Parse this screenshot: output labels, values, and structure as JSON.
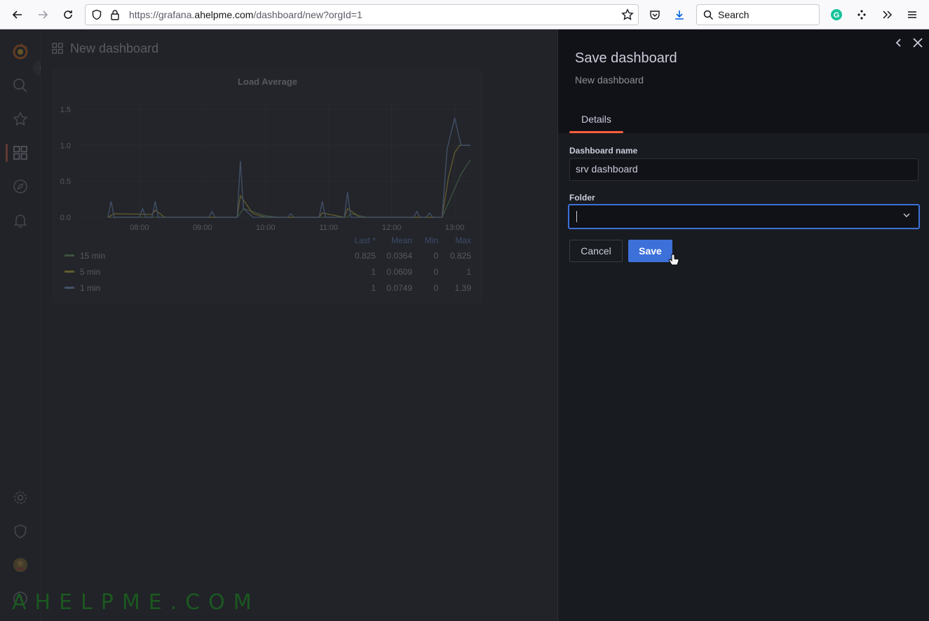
{
  "browser": {
    "url_prefix": "https://grafana.",
    "url_host": "ahelpme.com",
    "url_suffix": "/dashboard/new?orgId=1",
    "search_label": "Search"
  },
  "dashboard": {
    "title": "New dashboard"
  },
  "panel": {
    "title": "Load Average",
    "legend_headers": [
      "Last *",
      "Mean",
      "Min",
      "Max"
    ],
    "legend": [
      {
        "name": "15 min",
        "color": "#73bf69",
        "last": "0.825",
        "mean": "0.0364",
        "min": "0",
        "max": "0.825"
      },
      {
        "name": "5 min",
        "color": "#fade2a",
        "last": "1",
        "mean": "0.0609",
        "min": "0",
        "max": "1"
      },
      {
        "name": "1 min",
        "color": "#8ab8ff",
        "last": "1",
        "mean": "0.0749",
        "min": "0",
        "max": "1.39"
      }
    ]
  },
  "chart_data": {
    "type": "line",
    "title": "Load Average",
    "x_ticks": [
      "08:00",
      "09:00",
      "10:00",
      "11:00",
      "12:00",
      "13:00"
    ],
    "y_ticks": [
      "0.0",
      "0.5",
      "1.0",
      "1.5"
    ],
    "ylim": [
      0,
      1.5
    ],
    "grid": true,
    "series": [
      {
        "name": "1 min",
        "color": "#8ab8ff",
        "points": [
          [
            7.5,
            0
          ],
          [
            7.55,
            0.22
          ],
          [
            7.6,
            0
          ],
          [
            8.0,
            0
          ],
          [
            8.05,
            0.12
          ],
          [
            8.1,
            0
          ],
          [
            8.2,
            0
          ],
          [
            8.25,
            0.22
          ],
          [
            8.3,
            0
          ],
          [
            9.1,
            0
          ],
          [
            9.15,
            0.08
          ],
          [
            9.2,
            0
          ],
          [
            9.55,
            0
          ],
          [
            9.6,
            0.78
          ],
          [
            9.65,
            0.12
          ],
          [
            9.8,
            0
          ],
          [
            10.35,
            0
          ],
          [
            10.4,
            0.05
          ],
          [
            10.45,
            0
          ],
          [
            10.85,
            0
          ],
          [
            10.9,
            0.22
          ],
          [
            10.95,
            0
          ],
          [
            11.25,
            0
          ],
          [
            11.3,
            0.35
          ],
          [
            11.35,
            0
          ],
          [
            12.35,
            0
          ],
          [
            12.4,
            0.08
          ],
          [
            12.45,
            0
          ],
          [
            12.55,
            0
          ],
          [
            12.6,
            0.06
          ],
          [
            12.65,
            0
          ],
          [
            12.8,
            0
          ],
          [
            12.88,
            0.95
          ],
          [
            13.0,
            1.38
          ],
          [
            13.1,
            1.0
          ],
          [
            13.25,
            1.0
          ]
        ]
      },
      {
        "name": "5 min",
        "color": "#fade2a",
        "points": [
          [
            7.5,
            0
          ],
          [
            7.6,
            0.05
          ],
          [
            8.2,
            0.04
          ],
          [
            8.25,
            0.1
          ],
          [
            8.4,
            0
          ],
          [
            9.55,
            0
          ],
          [
            9.6,
            0.3
          ],
          [
            9.8,
            0.05
          ],
          [
            10.0,
            0
          ],
          [
            10.85,
            0
          ],
          [
            10.9,
            0.06
          ],
          [
            11.25,
            0
          ],
          [
            11.3,
            0.12
          ],
          [
            11.5,
            0
          ],
          [
            12.8,
            0
          ],
          [
            12.9,
            0.55
          ],
          [
            13.0,
            0.9
          ],
          [
            13.08,
            1.0
          ],
          [
            13.25,
            1.0
          ]
        ]
      },
      {
        "name": "15 min",
        "color": "#73bf69",
        "points": [
          [
            7.5,
            0
          ],
          [
            9.55,
            0
          ],
          [
            9.65,
            0.12
          ],
          [
            10.0,
            0.02
          ],
          [
            10.2,
            0
          ],
          [
            11.3,
            0
          ],
          [
            11.35,
            0.05
          ],
          [
            11.6,
            0
          ],
          [
            12.8,
            0
          ],
          [
            12.95,
            0.3
          ],
          [
            13.1,
            0.6
          ],
          [
            13.25,
            0.8
          ]
        ]
      }
    ]
  },
  "drawer": {
    "title": "Save dashboard",
    "subtitle": "New dashboard",
    "tab": "Details",
    "name_label": "Dashboard name",
    "name_value": "srv dashboard",
    "folder_label": "Folder",
    "cancel": "Cancel",
    "save": "Save"
  },
  "watermark": "AHELPME.COM"
}
